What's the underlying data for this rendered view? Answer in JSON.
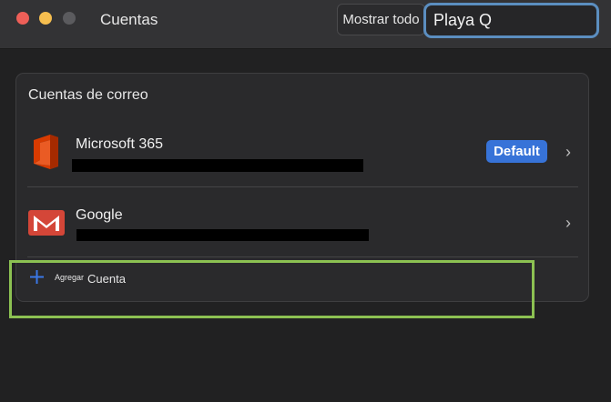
{
  "window": {
    "title": "Cuentas"
  },
  "toolbar": {
    "show_all_label": "Mostrar todo",
    "search_value": "Playa Q"
  },
  "section": {
    "title": "Cuentas de correo"
  },
  "accounts": [
    {
      "name": "Microsoft 365",
      "badge": "Default",
      "icon": "office-365-icon"
    },
    {
      "name": "Google",
      "icon": "gmail-icon"
    }
  ],
  "add_account": {
    "small_label": "Agregar",
    "label": "Cuenta",
    "icon": "plus-icon"
  },
  "colors": {
    "accent": "#3773d8",
    "highlight": "#8cc152",
    "search_focus": "#5b8ec0",
    "close": "#ee5f58",
    "minimize": "#f6be4f"
  }
}
